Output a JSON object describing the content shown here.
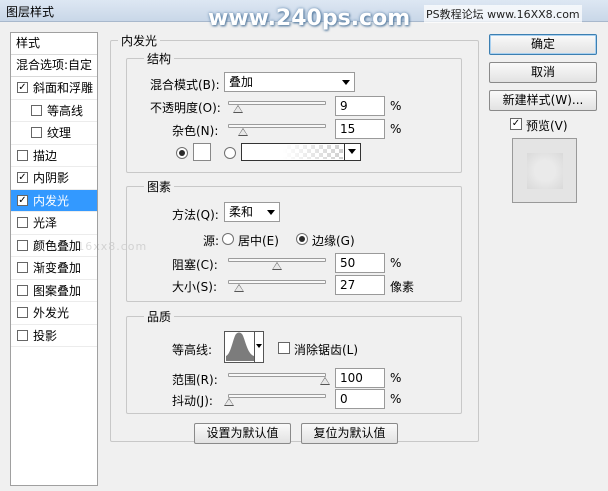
{
  "window": {
    "title": "图层样式"
  },
  "watermarks": {
    "main": "www.240ps.com",
    "corner": "PS教程论坛 www.16XX8.com",
    "faint": "bbs.16xx8.com"
  },
  "left_panel": {
    "header": "样式",
    "blend_options": "混合选项:自定",
    "items": [
      {
        "label": "斜面和浮雕",
        "checked": true,
        "indent": false,
        "selected": false,
        "mark": "✓"
      },
      {
        "label": "等高线",
        "checked": false,
        "indent": true,
        "selected": false,
        "mark": ""
      },
      {
        "label": "纹理",
        "checked": false,
        "indent": true,
        "selected": false,
        "mark": ""
      },
      {
        "label": "描边",
        "checked": false,
        "indent": false,
        "selected": false,
        "mark": ""
      },
      {
        "label": "内阴影",
        "checked": true,
        "indent": false,
        "selected": false,
        "mark": "✓"
      },
      {
        "label": "内发光",
        "checked": true,
        "indent": false,
        "selected": true,
        "mark": "✓"
      },
      {
        "label": "光泽",
        "checked": false,
        "indent": false,
        "selected": false,
        "mark": ""
      },
      {
        "label": "颜色叠加",
        "checked": false,
        "indent": false,
        "selected": false,
        "mark": ""
      },
      {
        "label": "渐变叠加",
        "checked": false,
        "indent": false,
        "selected": false,
        "mark": ""
      },
      {
        "label": "图案叠加",
        "checked": false,
        "indent": false,
        "selected": false,
        "mark": ""
      },
      {
        "label": "外发光",
        "checked": false,
        "indent": false,
        "selected": false,
        "mark": ""
      },
      {
        "label": "投影",
        "checked": false,
        "indent": false,
        "selected": false,
        "mark": ""
      }
    ]
  },
  "inner_glow": {
    "title": "内发光",
    "structure": {
      "title": "结构",
      "blend_mode_label": "混合模式(B):",
      "blend_mode_value": "叠加",
      "opacity_label": "不透明度(O):",
      "opacity_value": "9",
      "opacity_fraction": 0.09,
      "noise_label": "杂色(N):",
      "noise_value": "15",
      "noise_fraction": 0.15,
      "percent": "%"
    },
    "elements": {
      "title": "图素",
      "method_label": "方法(Q):",
      "method_value": "柔和",
      "source_label": "源:",
      "center_label": "居中(E)",
      "edge_label": "边缘(G)",
      "choke_label": "阻塞(C):",
      "choke_value": "50",
      "choke_fraction": 0.5,
      "size_label": "大小(S):",
      "size_value": "27",
      "size_fraction": 0.108,
      "size_unit": "像素",
      "percent": "%"
    },
    "quality": {
      "title": "品质",
      "contour_label": "等高线:",
      "anti_alias_label": "消除锯齿(L)",
      "range_label": "范围(R):",
      "range_value": "100",
      "range_fraction": 1.0,
      "jitter_label": "抖动(J):",
      "jitter_value": "0",
      "jitter_fraction": 0.0,
      "percent": "%"
    },
    "make_default": "设置为默认值",
    "reset_default": "复位为默认值"
  },
  "right_panel": {
    "ok": "确定",
    "cancel": "取消",
    "new_style": "新建样式(W)...",
    "preview_label": "预览(V)",
    "preview_checked": "✓"
  }
}
